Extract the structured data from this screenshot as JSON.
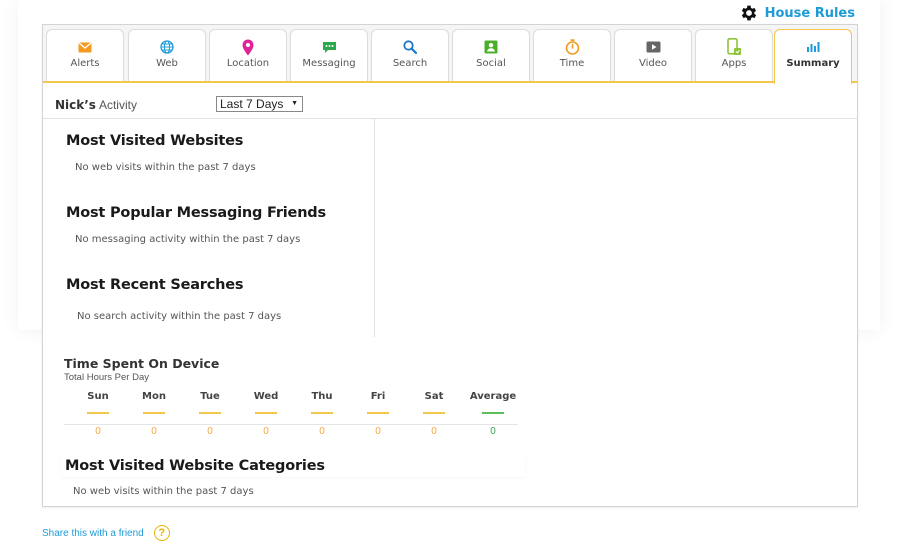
{
  "header": {
    "house_rules_label": "House Rules",
    "icon": "gear-icon"
  },
  "tabs": [
    {
      "label": "Alerts",
      "icon": "envelope-icon",
      "color": "#f39b21"
    },
    {
      "label": "Web",
      "icon": "globe-icon",
      "color": "#1e9bd7"
    },
    {
      "label": "Location",
      "icon": "map-pin-icon",
      "color": "#e0249a"
    },
    {
      "label": "Messaging",
      "icon": "chat-bubble-icon",
      "color": "#2aa84a"
    },
    {
      "label": "Search",
      "icon": "magnifier-icon",
      "color": "#1e78c8"
    },
    {
      "label": "Social",
      "icon": "contact-card-icon",
      "color": "#4caf2a"
    },
    {
      "label": "Time",
      "icon": "stopwatch-icon",
      "color": "#f39b21"
    },
    {
      "label": "Video",
      "icon": "play-icon",
      "color": "#666666"
    },
    {
      "label": "Apps",
      "icon": "phone-icon",
      "color": "#8cc43a"
    },
    {
      "label": "Summary",
      "icon": "bar-chart-icon",
      "color": "#1e9bd7",
      "active": true
    }
  ],
  "activity": {
    "owner": "Nick’s",
    "word": "Activity",
    "range_selected": "Last 7 Days"
  },
  "sections": {
    "websites": {
      "title": "Most Visited Websites",
      "empty": "No web visits within the past 7 days"
    },
    "messaging": {
      "title": "Most Popular Messaging Friends",
      "empty": "No messaging activity within the past 7 days"
    },
    "searches": {
      "title": "Most Recent Searches",
      "empty": "No search activity within the past 7 days"
    },
    "categories": {
      "title": "Most Visited Website Categories",
      "empty": "No web visits within the past 7 days"
    }
  },
  "time_spent": {
    "title": "Time Spent On Device",
    "subtitle": "Total Hours Per Day",
    "days": [
      {
        "name": "Sun",
        "value": "0"
      },
      {
        "name": "Mon",
        "value": "0"
      },
      {
        "name": "Tue",
        "value": "0"
      },
      {
        "name": "Wed",
        "value": "0"
      },
      {
        "name": "Thu",
        "value": "0"
      },
      {
        "name": "Fri",
        "value": "0"
      },
      {
        "name": "Sat",
        "value": "0"
      },
      {
        "name": "Average",
        "value": "0"
      }
    ],
    "day_color": "#f3a93c",
    "average_color": "#3aa655"
  },
  "footer": {
    "share_label": "Share this with a friend",
    "help_glyph": "?"
  }
}
